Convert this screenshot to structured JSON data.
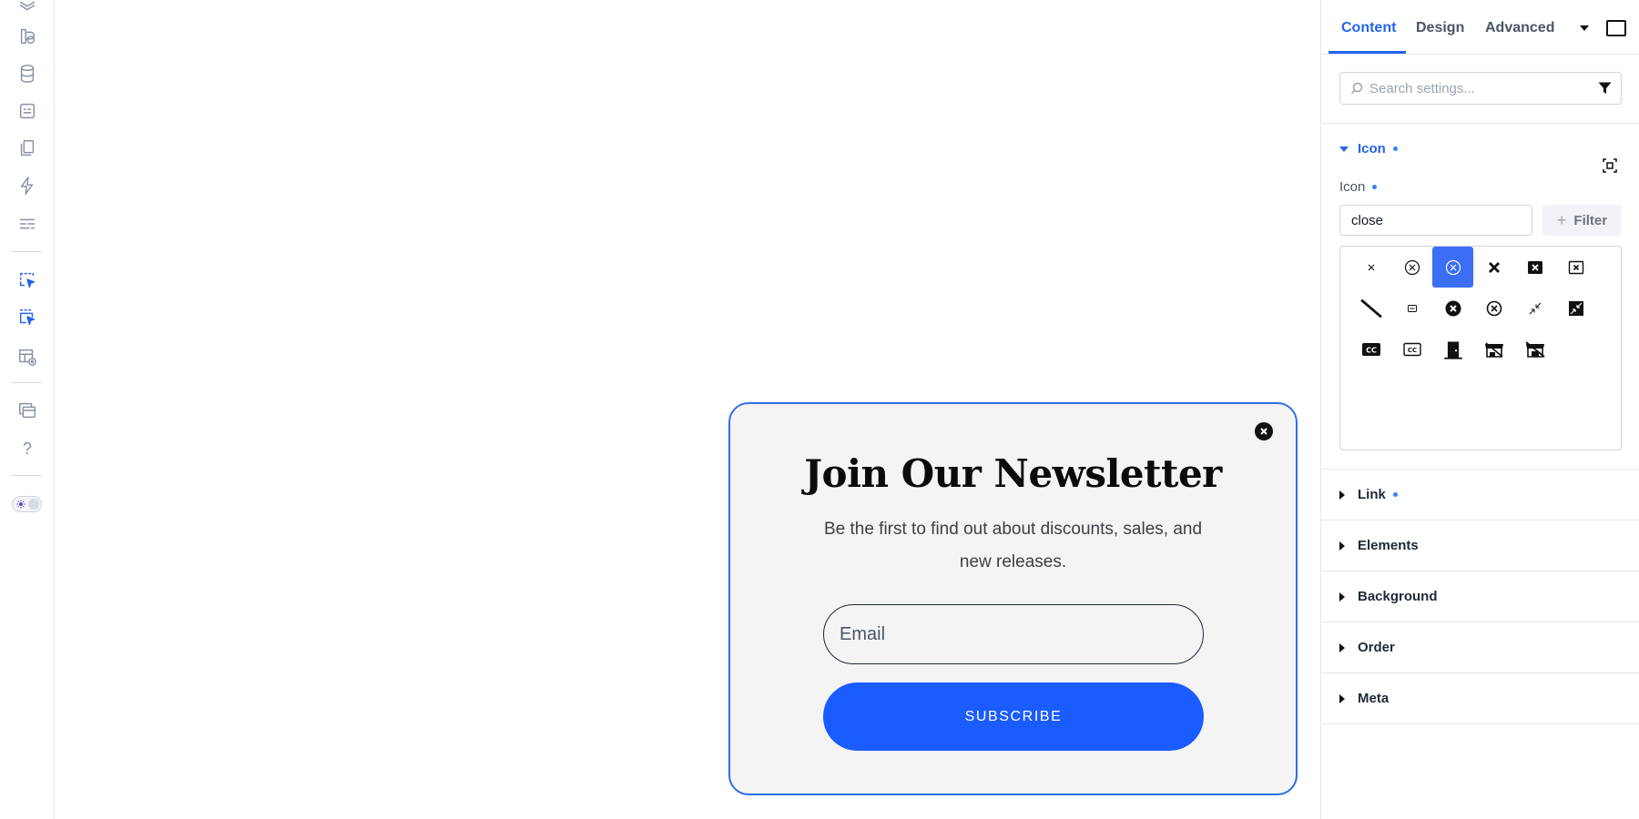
{
  "rail": {
    "items": [
      "layers-icon",
      "shapes-icon",
      "database-icon",
      "form-icon",
      "pages-icon",
      "bolt-icon",
      "sections-icon",
      "popup-trigger-icon",
      "popup-list-icon",
      "templates-icon",
      "windows-icon",
      "help-icon"
    ],
    "help_label": "?"
  },
  "popup": {
    "title": "Join Our Newsletter",
    "subtitle": "Be the first to find out about discounts, sales, and new releases.",
    "email_placeholder": "Email",
    "button_label": "SUBSCRIBE"
  },
  "panel": {
    "tabs": [
      {
        "label": "Content",
        "active": true
      },
      {
        "label": "Design",
        "active": false
      },
      {
        "label": "Advanced",
        "active": false
      }
    ],
    "search_placeholder": "Search settings...",
    "icon_section": {
      "title": "Icon",
      "field_label": "Icon",
      "field_value": "close",
      "filter_label": "Filter",
      "icons": [
        "close-icon",
        "close-circle-outline-icon",
        "close-circle-selected-icon",
        "close-bold-icon",
        "close-box-filled-icon",
        "close-box-outline-icon",
        "slash-icon",
        "minus-box-icon",
        "close-circle-filled-icon",
        "close-circle-outline-alt-icon",
        "collapse-icon",
        "collapse-box-icon",
        "closed-caption-filled-icon",
        "closed-caption-outline-icon",
        "door-closed-icon",
        "store-closed-icon",
        "store-closed-alt-icon"
      ],
      "selected_index": 2
    },
    "sections": [
      {
        "label": "Link",
        "has_dot": true
      },
      {
        "label": "Elements",
        "has_dot": false
      },
      {
        "label": "Background",
        "has_dot": false
      },
      {
        "label": "Order",
        "has_dot": false
      },
      {
        "label": "Meta",
        "has_dot": false
      }
    ]
  },
  "colors": {
    "accent": "#2563eb",
    "subscribe_button": "#1a5cff",
    "popup_border": "#2f6fe4",
    "popup_bg": "#f4f4f5"
  }
}
